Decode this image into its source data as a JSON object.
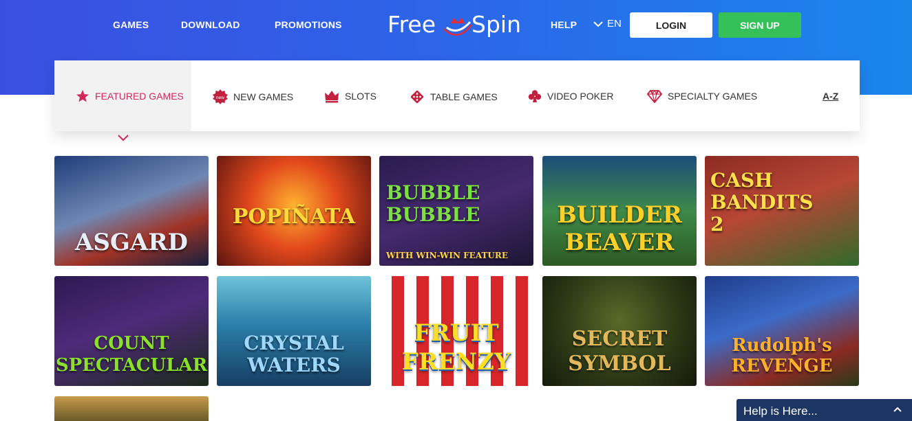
{
  "nav": {
    "games": "GAMES",
    "download": "DOWNLOAD",
    "promotions": "PROMOTIONS",
    "help": "HELP",
    "language": "EN",
    "login": "LOGIN",
    "signup": "SIGN UP"
  },
  "logo": {
    "word1": "Free",
    "word2": "Spin"
  },
  "categories": {
    "featured": "FEATURED GAMES",
    "new": "NEW GAMES",
    "new_badge": "new",
    "slots": "SLOTS",
    "table": "TABLE GAMES",
    "video_poker": "VIDEO POKER",
    "specialty": "SPECIALTY GAMES",
    "az": "A-Z"
  },
  "games": [
    {
      "title": "ASGARD"
    },
    {
      "title": "POPIÑATA"
    },
    {
      "title": "BUBBLE BUBBLE",
      "sub": "WITH WIN-WIN FEATURE"
    },
    {
      "title": "BUILDER BEAVER"
    },
    {
      "title": "CASH BANDITS 2"
    },
    {
      "title": "COUNT SPECTACULAR"
    },
    {
      "title": "CRYSTAL WATERS"
    },
    {
      "title": "FRUIT FRENZY"
    },
    {
      "title": "SECRET SYMBOL"
    },
    {
      "title": "Rudolph's REVENGE"
    }
  ],
  "chat": {
    "label": "Help is Here..."
  },
  "colors": {
    "accent": "#d02759",
    "signup": "#35c05a",
    "header_start": "#3a4fe0",
    "header_end": "#1a86ec"
  }
}
